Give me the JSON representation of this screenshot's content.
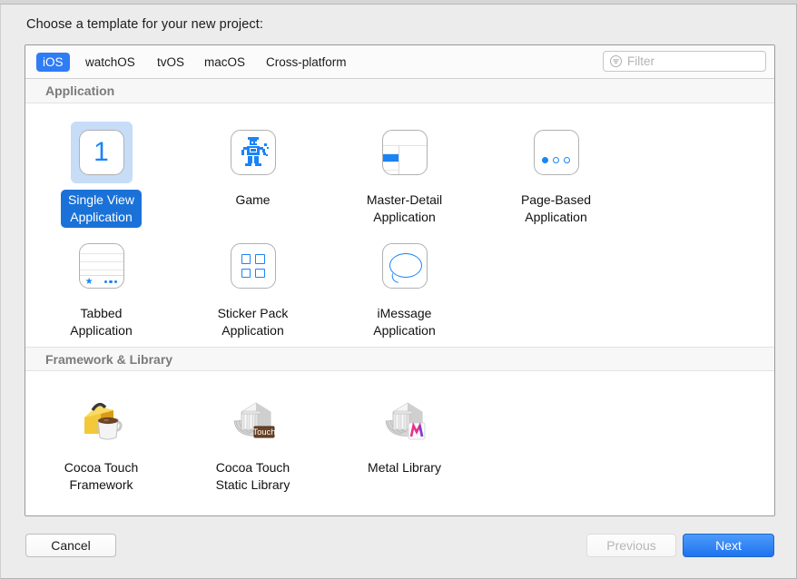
{
  "dialog": {
    "prompt": "Choose a template for your new project:"
  },
  "platform_tabs": [
    {
      "label": "iOS",
      "selected": true
    },
    {
      "label": "watchOS",
      "selected": false
    },
    {
      "label": "tvOS",
      "selected": false
    },
    {
      "label": "macOS",
      "selected": false
    },
    {
      "label": "Cross-platform",
      "selected": false
    }
  ],
  "filter": {
    "value": "",
    "placeholder": "Filter",
    "icon": "filter-circle-icon"
  },
  "sections": [
    {
      "title": "Application",
      "templates": [
        {
          "label": "Single View\nApplication",
          "line1": "Single View",
          "line2": "Application",
          "icon": "single-view-icon",
          "selected": true
        },
        {
          "label": "Game",
          "line1": "Game",
          "line2": "",
          "icon": "game-robot-icon",
          "selected": false
        },
        {
          "label": "Master-Detail Application",
          "line1": "Master-Detail",
          "line2": "Application",
          "icon": "master-detail-icon",
          "selected": false
        },
        {
          "label": "Page-Based Application",
          "line1": "Page-Based",
          "line2": "Application",
          "icon": "page-based-icon",
          "selected": false
        },
        {
          "label": "Tabbed Application",
          "line1": "Tabbed",
          "line2": "Application",
          "icon": "tabbed-icon",
          "selected": false
        },
        {
          "label": "Sticker Pack Application",
          "line1": "Sticker Pack",
          "line2": "Application",
          "icon": "sticker-pack-icon",
          "selected": false
        },
        {
          "label": "iMessage Application",
          "line1": "iMessage",
          "line2": "Application",
          "icon": "imessage-icon",
          "selected": false
        }
      ]
    },
    {
      "title": "Framework & Library",
      "templates": [
        {
          "label": "Cocoa Touch Framework",
          "line1": "Cocoa Touch",
          "line2": "Framework",
          "icon": "toolbox-coffee-icon",
          "selected": false
        },
        {
          "label": "Cocoa Touch Static Library",
          "line1": "Cocoa Touch",
          "line2": "Static Library",
          "icon": "library-touch-icon",
          "selected": false
        },
        {
          "label": "Metal Library",
          "line1": "Metal Library",
          "line2": "",
          "icon": "library-metal-icon",
          "selected": false
        }
      ]
    }
  ],
  "footer": {
    "cancel_label": "Cancel",
    "previous_label": "Previous",
    "next_label": "Next"
  },
  "colors": {
    "accent_blue": "#2f7cf6",
    "selection_tint": "#c7dcf7",
    "label_blue": "#1a72d8",
    "icon_blue": "#1a84f7",
    "metal_pink": "#e8308a",
    "toolbox_yellow": "#f0c32c",
    "touch_badge_brown": "#6b4326"
  }
}
